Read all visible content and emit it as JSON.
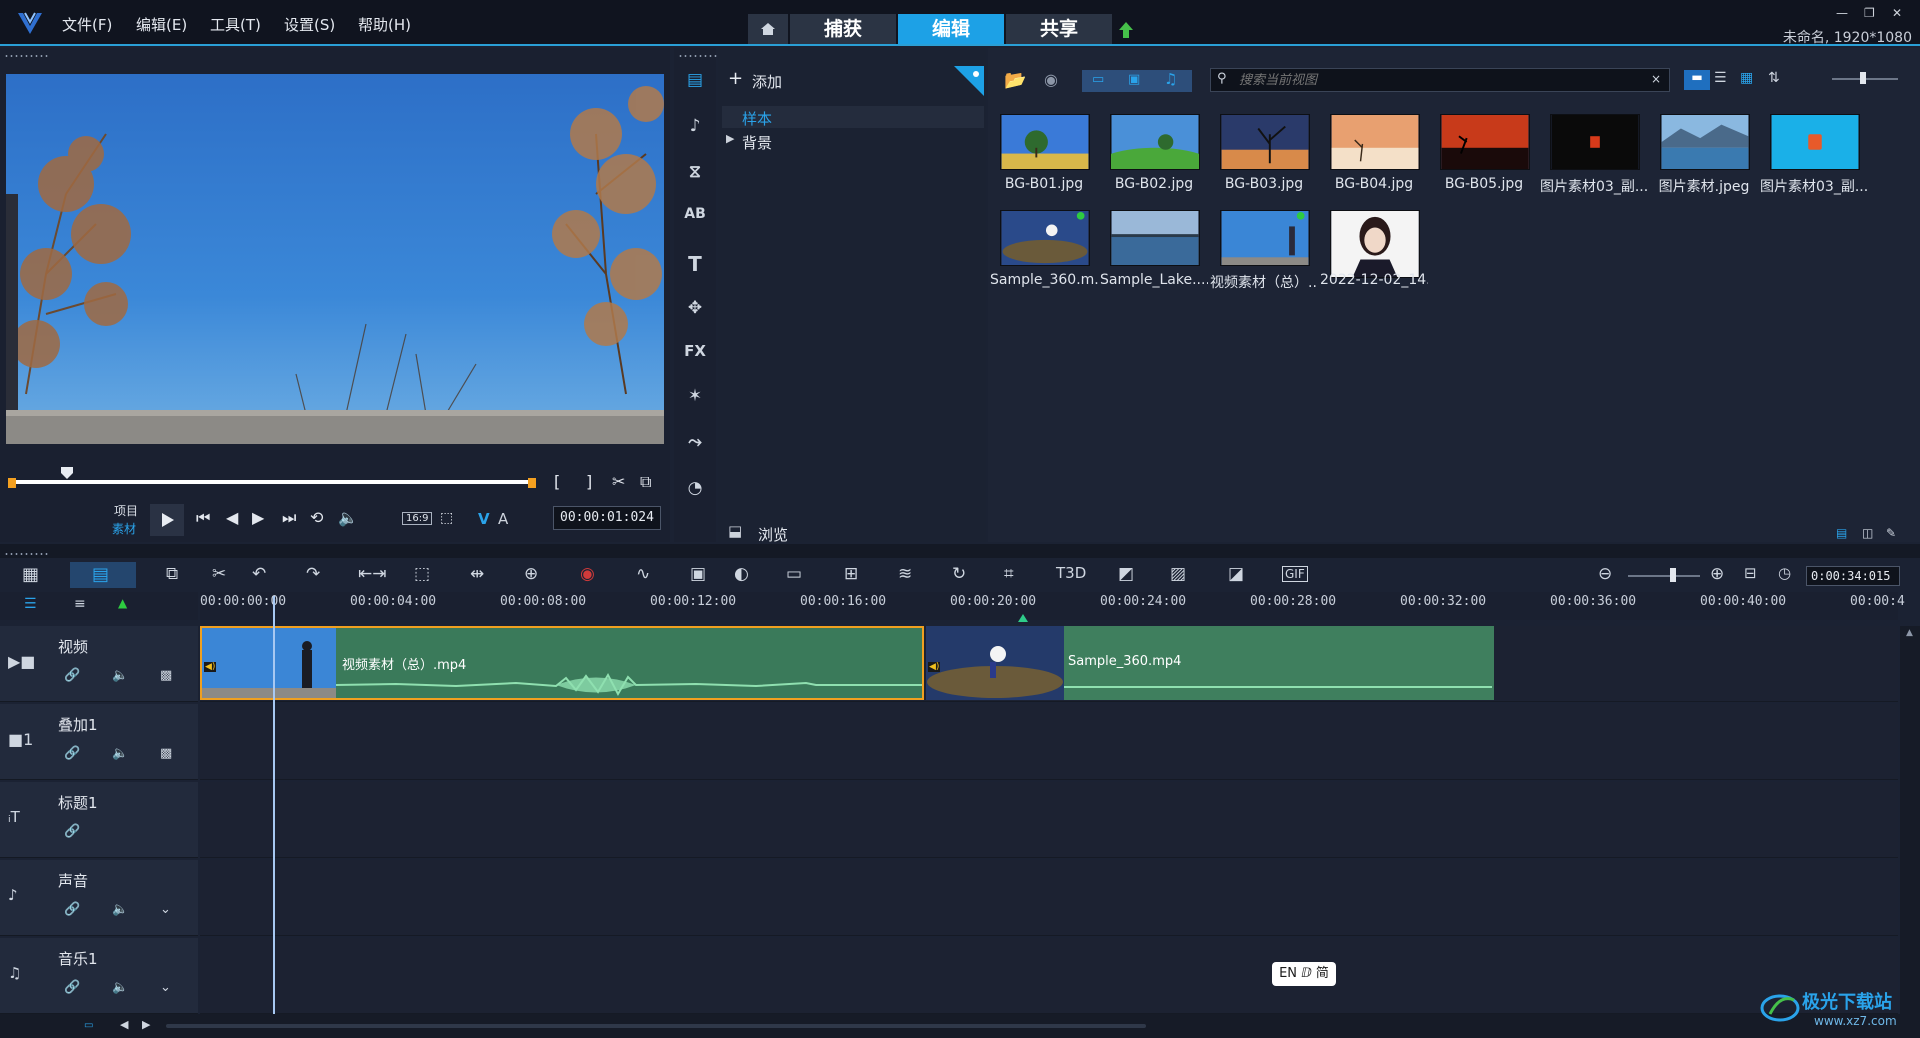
{
  "app": {
    "window_info": "未命名, 1920*1080",
    "menu": [
      "文件(F)",
      "编辑(E)",
      "工具(T)",
      "设置(S)",
      "帮助(H)"
    ],
    "modes": [
      "捕获",
      "编辑",
      "共享"
    ],
    "active_mode": "编辑"
  },
  "preview": {
    "project_label": "项目",
    "clip_label": "素材",
    "aspect": "16:9",
    "timecode": "00:00:01:024",
    "v_label": "V",
    "a_label": "A"
  },
  "library": {
    "add_label": "添加",
    "tree": [
      "样本",
      "背景"
    ],
    "tree_selected": "样本",
    "browse_label": "浏览",
    "search_placeholder": "搜索当前视图",
    "items": [
      {
        "name": "BG-B01.jpg"
      },
      {
        "name": "BG-B02.jpg"
      },
      {
        "name": "BG-B03.jpg"
      },
      {
        "name": "BG-B04.jpg"
      },
      {
        "name": "BG-B05.jpg"
      },
      {
        "name": "图片素材03_副..."
      },
      {
        "name": "图片素材.jpeg"
      },
      {
        "name": "图片素材03_副..."
      },
      {
        "name": "Sample_360.m..."
      },
      {
        "name": "Sample_Lake...."
      },
      {
        "name": "视频素材（总）...."
      },
      {
        "name": "2022-12-02_14..."
      }
    ]
  },
  "timeline": {
    "duration": "0:00:34:015",
    "ruler": [
      "00:00:00:00",
      "00:00:04:00",
      "00:00:08:00",
      "00:00:12:00",
      "00:00:16:00",
      "00:00:20:00",
      "00:00:24:00",
      "00:00:28:00",
      "00:00:32:00",
      "00:00:36:00",
      "00:00:40:00",
      "00:00:4"
    ],
    "tracks": [
      "视频",
      "叠加1",
      "标题1",
      "声音",
      "音乐1"
    ],
    "clips": [
      {
        "label": "视频素材（总）.mp4"
      },
      {
        "label": "Sample_360.mp4"
      }
    ]
  },
  "ime": {
    "text": "EN ⅅ 简"
  },
  "watermark": {
    "text": "极光下载站",
    "url_text": "www.xz7.com"
  }
}
